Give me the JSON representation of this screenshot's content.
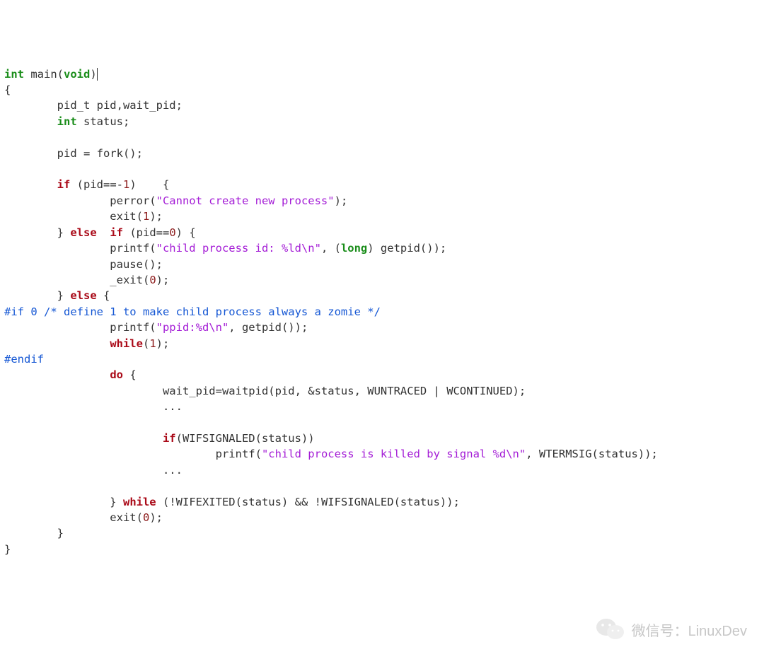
{
  "code": {
    "ty_int": "int",
    "fn_main": " main(",
    "ty_void": "void",
    "fn_main_close": ")",
    "lbrace": "{",
    "l2_a": "        pid_t pid,wait_pid;",
    "l3_a": "        ",
    "l3_b": " status;",
    "l4_a": "        pid = fork();",
    "if1_a": "        ",
    "kw_if": "if",
    "if1_b": " (pid==-",
    "if1_num": "1",
    "if1_c": ")    {",
    "perror_a": "                perror(",
    "str_perror": "\"Cannot create new process\"",
    "perror_b": ");",
    "exit1_a": "                exit(",
    "exit1_num": "1",
    "exit1_b": ");",
    "else1_a": "        } ",
    "kw_else": "else",
    "else1_b": "  ",
    "else1_c": " (pid==",
    "else1_num": "0",
    "else1_d": ") {",
    "printf1_a": "                printf(",
    "str_printf1": "\"child process id: %ld\\n\"",
    "printf1_b": ", (",
    "ty_long": "long",
    "printf1_c": ") getpid());",
    "pause_a": "                pause();",
    "exit0_a": "                _exit(",
    "exit0_num": "0",
    "exit0_b": ");",
    "else2_a": "        } ",
    "else2_b": " {",
    "pp_line": "#if 0 /* define 1 to make child process always a zomie */",
    "printf2_a": "                printf(",
    "str_printf2": "\"ppid:%d\\n\"",
    "printf2_b": ", getpid());",
    "while1_a": "                ",
    "kw_while": "while",
    "while1_b": "(",
    "while1_num": "1",
    "while1_c": ");",
    "pp_endif": "#endif",
    "do_a": "                ",
    "kw_do": "do",
    "do_b": " {",
    "waitpid_a": "                        wait_pid=waitpid(pid, &status, WUNTRACED | WCONTINUED);",
    "dots1": "                        ...",
    "if2_a": "                        ",
    "if2_b": "(WIFSIGNALED(status))",
    "printf3_a": "                                printf(",
    "str_printf3": "\"child process is killed by signal %d\\n\"",
    "printf3_b": ", WTERMSIG(status));",
    "dots2": "                        ...",
    "dowhile_a": "                } ",
    "dowhile_b": " (!WIFEXITED(status) && !WIFSIGNALED(status));",
    "exit2_a": "                exit(",
    "exit2_num": "0",
    "exit2_b": ");",
    "close_inner": "        }",
    "close_outer": "}"
  },
  "watermark": {
    "label": "微信号：LinuxDev"
  }
}
